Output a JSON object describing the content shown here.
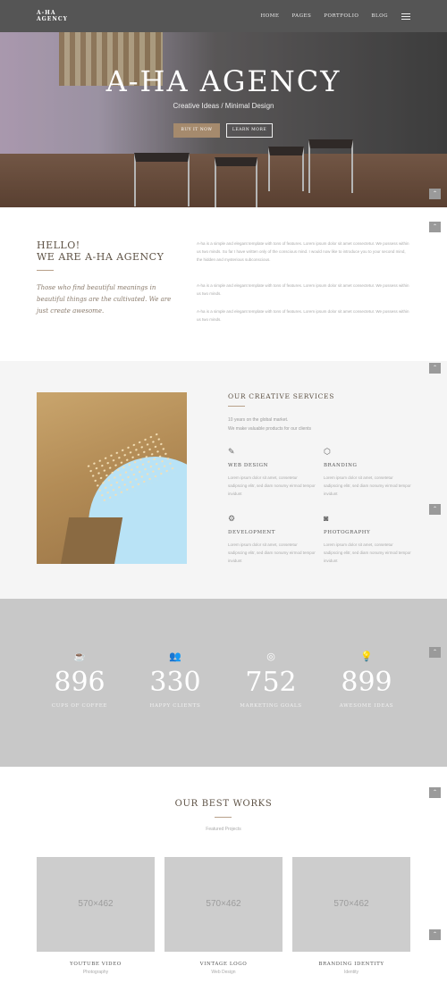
{
  "nav": {
    "logo_line1": "A-HA",
    "logo_line2": "AGENCY",
    "items": [
      "HOME",
      "PAGES",
      "PORTFOLIO",
      "BLOG"
    ]
  },
  "hero": {
    "title": "A-HA AGENCY",
    "subtitle": "Creative Ideas / Minimal Design",
    "primary_button": "BUY IT NOW",
    "secondary_button": "LEARN MORE"
  },
  "back_to_top_icon": "chevron-up-icon",
  "about": {
    "heading_line1": "HELLO!",
    "heading_line2": "WE ARE A-HA AGENCY",
    "tagline": "Those who find beautiful meanings in beautiful things are the cultivated. We are just create awesome.",
    "paragraphs": [
      "A-ha is a simple and elegant template with tons of features. Lorem ipsum dolor sit amet consectetur. We possess within us two minds. So far I have written only of the conscious mind. I would now like to introduce you to your second mind, the hidden and mysterious subconscious.",
      "A-ha is a simple and elegant template with tons of features. Lorem ipsum dolor sit amet consectetur. We possess within us two minds.",
      "A-ha is a simple and elegant template with tons of features. Lorem ipsum dolor sit amet consectetur. We possess within us two minds."
    ]
  },
  "services": {
    "title": "OUR CREATIVE SERVICES",
    "intro_line1": "10 years on the global market.",
    "intro_line2": "We make valuable products for our clients",
    "items": [
      {
        "icon": "pen-nib-icon",
        "name": "WEB DESIGN",
        "desc": "Lorem ipsum dolor sit amet, consetetur sadipscing elitr, sed diam nonumy eirmod tempor invidunt"
      },
      {
        "icon": "cube-icon",
        "name": "BRANDING",
        "desc": "Lorem ipsum dolor sit amet, consetetur sadipscing elitr, sed diam nonumy eirmod tempor invidunt"
      },
      {
        "icon": "gear-icon",
        "name": "DEVELOPMENT",
        "desc": "Lorem ipsum dolor sit amet, consetetur sadipscing elitr, sed diam nonumy eirmod tempor invidunt"
      },
      {
        "icon": "camera-icon",
        "name": "PHOTOGRAPHY",
        "desc": "Lorem ipsum dolor sit amet, consetetur sadipscing elitr, sed diam nonumy eirmod tempor invidunt"
      }
    ]
  },
  "counters": [
    {
      "icon": "coffee-cup-icon",
      "value": "896",
      "label": "CUPS OF COFFEE"
    },
    {
      "icon": "users-icon",
      "value": "330",
      "label": "HAPPY CLIENTS"
    },
    {
      "icon": "target-icon",
      "value": "752",
      "label": "MARKETING GOALS"
    },
    {
      "icon": "lightbulb-icon",
      "value": "899",
      "label": "AWESOME IDEAS"
    }
  ],
  "works": {
    "title": "OUR BEST WORKS",
    "subtitle": "Featured Projects",
    "items": [
      {
        "placeholder": "570×462",
        "name": "YOUTUBE VIDEO",
        "category": "Photography"
      },
      {
        "placeholder": "570×462",
        "name": "VINTAGE LOGO",
        "category": "Web Design"
      },
      {
        "placeholder": "570×462",
        "name": "BRANDING IDENTITY",
        "category": "Identity"
      }
    ]
  }
}
